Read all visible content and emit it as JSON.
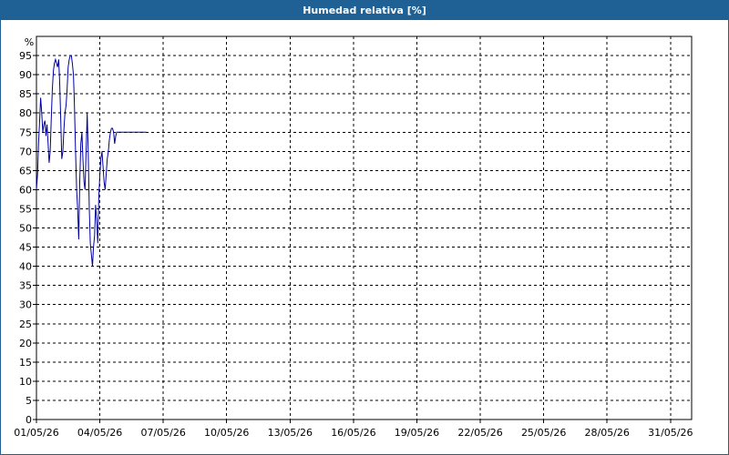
{
  "window": {
    "title": "Humedad relativa [%]"
  },
  "chart_data": {
    "type": "line",
    "title": "Humedad relativa [%]",
    "ylabel": "%",
    "xlabel": "",
    "ylim": [
      0,
      100
    ],
    "xlim": [
      "01/05/26",
      "01/06/26"
    ],
    "grid": true,
    "y_ticks": [
      0,
      5,
      10,
      15,
      20,
      25,
      30,
      35,
      40,
      45,
      50,
      55,
      60,
      65,
      70,
      75,
      80,
      85,
      90,
      95
    ],
    "x_ticks": [
      "01/05/26",
      "04/05/26",
      "07/05/26",
      "10/05/26",
      "13/05/26",
      "16/05/26",
      "19/05/26",
      "22/05/26",
      "25/05/26",
      "28/05/26",
      "31/05/26"
    ],
    "series": [
      {
        "color": "#0000a0",
        "x_days": [
          0.0,
          0.05,
          0.1,
          0.15,
          0.2,
          0.25,
          0.3,
          0.35,
          0.4,
          0.45,
          0.5,
          0.55,
          0.6,
          0.65,
          0.7,
          0.75,
          0.8,
          0.85,
          0.9,
          0.95,
          1.0,
          1.05,
          1.1,
          1.15,
          1.2,
          1.25,
          1.3,
          1.35,
          1.4,
          1.45,
          1.5,
          1.55,
          1.6,
          1.65,
          1.7,
          1.75,
          1.8,
          1.85,
          1.9,
          1.95,
          2.0,
          2.05,
          2.1,
          2.15,
          2.2,
          2.25,
          2.3,
          2.35,
          2.4,
          2.45,
          2.5,
          2.55,
          2.6,
          2.65,
          2.7,
          2.75,
          2.8,
          2.85,
          2.9,
          2.95,
          3.0,
          3.05,
          3.1,
          3.15,
          3.2,
          3.25,
          3.3,
          3.35,
          3.4,
          3.45,
          3.5,
          3.55,
          3.6,
          3.65,
          3.7,
          3.75,
          3.8,
          3.85,
          3.9,
          3.95,
          4.0,
          4.05,
          4.1,
          4.15,
          4.2,
          4.25,
          4.3,
          4.35,
          4.4,
          4.45,
          4.5,
          4.55,
          4.6,
          4.65,
          4.7,
          4.75,
          4.8,
          4.85,
          4.9,
          4.95,
          5.0,
          5.05,
          5.1,
          5.15,
          5.2
        ],
        "values": [
          60,
          64,
          72,
          78,
          84,
          80,
          75,
          77,
          78,
          74,
          77,
          72,
          67,
          70,
          78,
          86,
          91,
          93,
          94,
          93,
          92,
          94,
          88,
          78,
          68,
          70,
          76,
          80,
          82,
          86,
          92,
          94,
          95,
          95,
          93,
          90,
          82,
          70,
          60,
          55,
          47,
          62,
          72,
          75,
          68,
          62,
          60,
          70,
          80,
          70,
          55,
          46,
          43,
          40,
          45,
          48,
          56,
          52,
          46,
          58,
          64,
          68,
          70,
          66,
          62,
          60,
          64,
          68,
          70,
          73,
          75,
          76,
          76,
          75,
          72,
          74,
          75,
          75,
          75,
          75,
          75,
          75,
          75,
          75,
          75,
          75,
          75,
          75,
          75,
          75,
          75,
          75,
          75,
          75,
          75,
          75,
          75,
          75,
          75,
          75,
          75,
          75,
          75,
          75,
          75
        ]
      }
    ]
  }
}
